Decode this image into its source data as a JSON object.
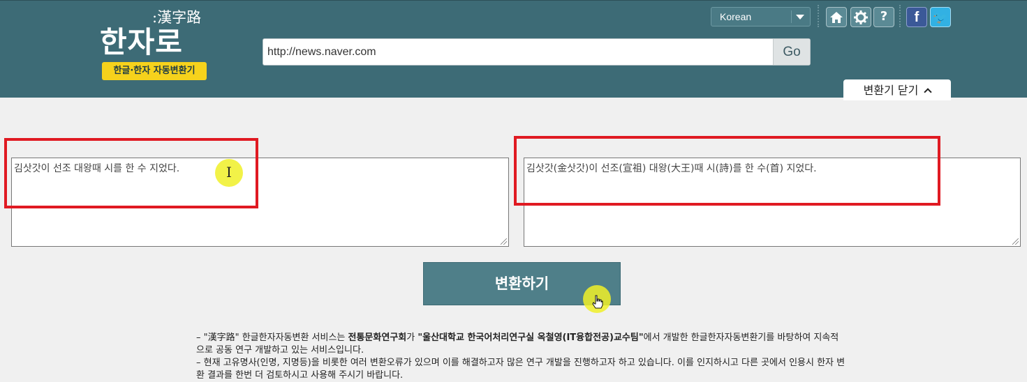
{
  "header": {
    "logo_hanja": ":漢字路",
    "logo_hangul": "한자로",
    "logo_badge": "한글·한자 자동변환기",
    "url_value": "http://news.naver.com",
    "go_label": "Go",
    "language": "Korean",
    "close_tab_label": "변환기 닫기"
  },
  "icons": {
    "home": "home-icon",
    "settings": "gear-icon",
    "help": "question-icon",
    "help_glyph": "?",
    "facebook": "facebook-icon",
    "facebook_glyph": "f",
    "twitter": "twitter-icon",
    "twitter_glyph": "🐦"
  },
  "converter": {
    "input_text": "김삿갓이 선조 대왕때 시를 한 수 지었다.",
    "output_text": "김삿갓(金삿갓)이 선조(宣祖) 대왕(大王)때 시(詩)를 한 수(首) 지었다.",
    "convert_label": "변환하기"
  },
  "notice": {
    "line1_prefix": "– \"漢字路\" 한글한자자동변환 서비스는 ",
    "line1_bold1": "전통문화연구회",
    "line1_mid": "가 ",
    "line1_bold2": "\"울산대학교 한국어처리연구실 옥철영(IT융합전공)교수팀\"",
    "line1_suffix": "에서 개발한 한글한자자동변환기를 바탕하여 지속적으로 공동 연구 개발하고 있는 서비스입니다.",
    "line2": "– 현재 고유명사(인명, 지명등)을 비롯한 여러 변환오류가 있으며 이를 해결하고자 많은 연구 개발을 진행하고자 하고 있습니다. 이를 인지하시고 다른 곳에서 인용시 한자 변환 결과를 한번 더 검토하시고 사용해 주시기 바랍니다."
  },
  "colors": {
    "header_bg": "#3d6b76",
    "badge_yellow": "#f6d21c",
    "button_teal": "#4f7f89",
    "highlight_red": "#e01a22"
  }
}
